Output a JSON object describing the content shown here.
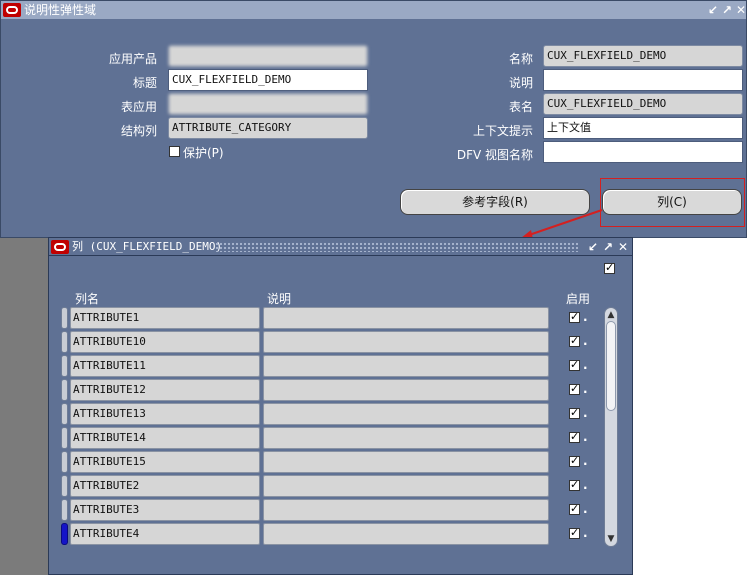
{
  "main_window": {
    "title": "说明性弹性域",
    "fields": {
      "application_product_label": "应用产品",
      "title_label": "标题",
      "title_value": "CUX_FLEXFIELD_DEMO",
      "table_application_label": "表应用",
      "structure_column_label": "结构列",
      "structure_column_value": "ATTRIBUTE_CATEGORY",
      "protect_label": "保护(P)",
      "name_label": "名称",
      "name_value": "CUX_FLEXFIELD_DEMO",
      "description_label": "说明",
      "description_value": "",
      "table_name_label": "表名",
      "table_name_value": "CUX_FLEXFIELD_DEMO",
      "context_prompt_label": "上下文提示",
      "context_prompt_value": "上下文值",
      "dfv_view_name_label": "DFV 视图名称",
      "dfv_view_name_value": ""
    },
    "buttons": {
      "reference_fields": "参考字段(R)",
      "columns": "列(C)"
    }
  },
  "columns_window": {
    "title": "列 (CUX_FLEXFIELD_DEMO)",
    "headers": {
      "column_name": "列名",
      "description": "说明",
      "enabled": "启用"
    },
    "rows": [
      {
        "name": "ATTRIBUTE1",
        "description": "",
        "enabled": true
      },
      {
        "name": "ATTRIBUTE10",
        "description": "",
        "enabled": true
      },
      {
        "name": "ATTRIBUTE11",
        "description": "",
        "enabled": true
      },
      {
        "name": "ATTRIBUTE12",
        "description": "",
        "enabled": true
      },
      {
        "name": "ATTRIBUTE13",
        "description": "",
        "enabled": true
      },
      {
        "name": "ATTRIBUTE14",
        "description": "",
        "enabled": true
      },
      {
        "name": "ATTRIBUTE15",
        "description": "",
        "enabled": true
      },
      {
        "name": "ATTRIBUTE2",
        "description": "",
        "enabled": true
      },
      {
        "name": "ATTRIBUTE3",
        "description": "",
        "enabled": true
      },
      {
        "name": "ATTRIBUTE4",
        "description": "",
        "enabled": true
      }
    ]
  },
  "colors": {
    "window_bg": "#5f7194",
    "titlebar_bg": "#9aa9c4",
    "field_readonly": "#d6d6d6",
    "annotation_red": "#d42020",
    "current_row_marker": "#1414c8"
  }
}
